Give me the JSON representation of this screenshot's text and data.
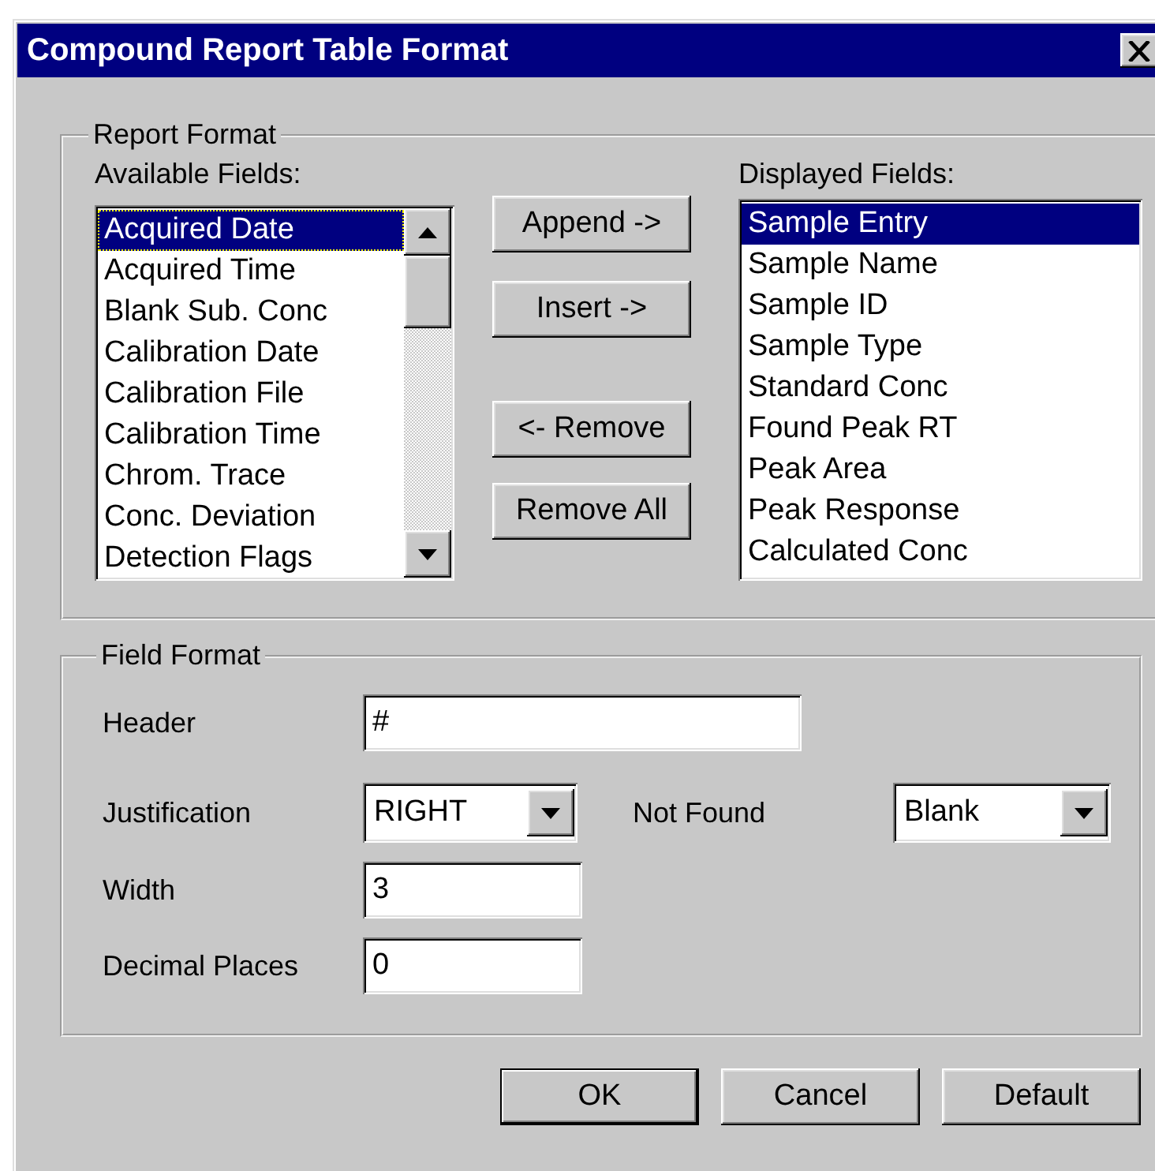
{
  "window": {
    "title": "Compound Report Table Format"
  },
  "report_format": {
    "title": "Report Format",
    "available_fields": {
      "label": "Available Fields:",
      "items": [
        {
          "label": "Acquired Date",
          "selected": true
        },
        {
          "label": "Acquired Time",
          "selected": false
        },
        {
          "label": "Blank Sub. Conc",
          "selected": false
        },
        {
          "label": "Calibration Date",
          "selected": false
        },
        {
          "label": "Calibration File",
          "selected": false
        },
        {
          "label": "Calibration Time",
          "selected": false
        },
        {
          "label": "Chrom. Trace",
          "selected": false
        },
        {
          "label": "Conc. Deviation",
          "selected": false
        },
        {
          "label": "Detection Flags",
          "selected": false
        }
      ]
    },
    "buttons": [
      {
        "label": "Append ->"
      },
      {
        "label": "Insert ->"
      },
      {
        "label": "<- Remove"
      },
      {
        "label": "Remove All"
      }
    ],
    "displayed_fields": {
      "label": "Displayed Fields:",
      "items": [
        {
          "label": "Sample Entry",
          "selected": true
        },
        {
          "label": "Sample Name",
          "selected": false
        },
        {
          "label": "Sample ID",
          "selected": false
        },
        {
          "label": "Sample Type",
          "selected": false
        },
        {
          "label": "Standard Conc",
          "selected": false
        },
        {
          "label": "Found Peak RT",
          "selected": false
        },
        {
          "label": "Peak Area",
          "selected": false
        },
        {
          "label": "Peak Response",
          "selected": false
        },
        {
          "label": "Calculated Conc",
          "selected": false
        }
      ]
    }
  },
  "field_format": {
    "title": "Field Format",
    "header": {
      "label": "Header",
      "value": "#"
    },
    "justification": {
      "label": "Justification",
      "value": "RIGHT"
    },
    "not_found": {
      "label": "Not Found",
      "value": "Blank"
    },
    "width": {
      "label": "Width",
      "value": "3"
    },
    "decimal_places": {
      "label": "Decimal Places",
      "value": "0"
    }
  },
  "buttons": [
    {
      "label": "OK",
      "default": true
    },
    {
      "label": "Cancel",
      "default": false
    },
    {
      "label": "Default",
      "default": false
    }
  ]
}
